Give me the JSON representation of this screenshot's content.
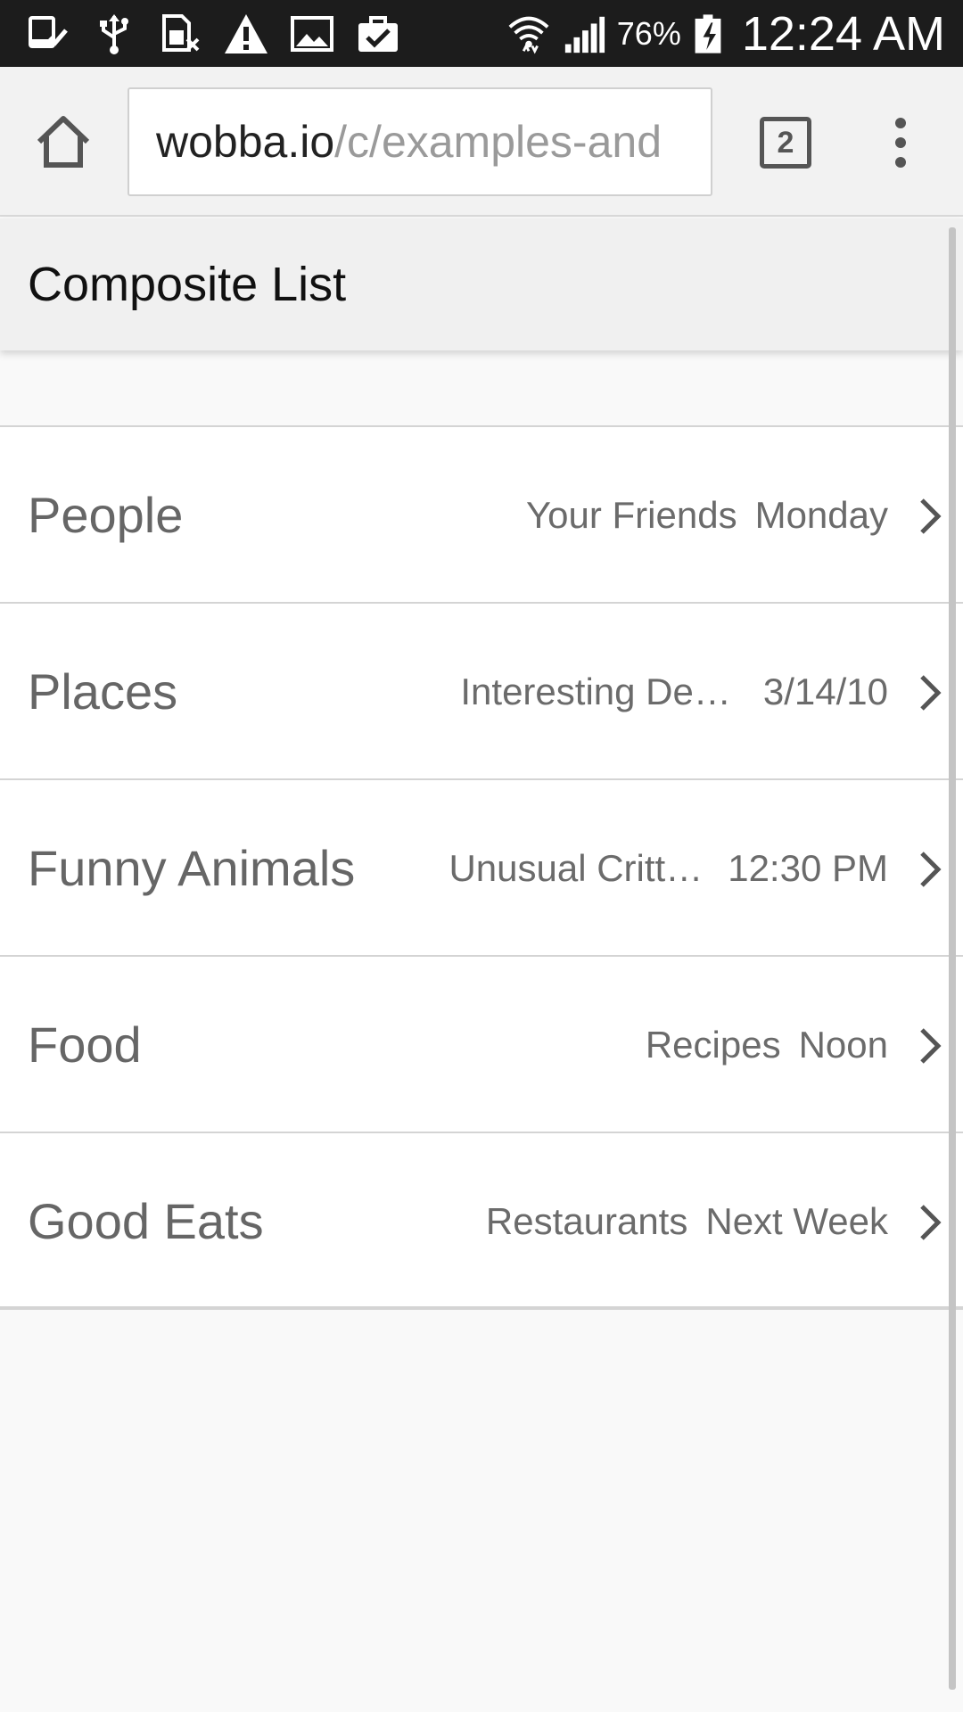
{
  "status_bar": {
    "icons_left": [
      "download-done-icon",
      "usb-icon",
      "sim-card-error-icon",
      "warning-icon",
      "gallery-icon",
      "clipboard-check-icon"
    ],
    "icons_right": [
      "wifi-icon",
      "cell-signal-icon",
      "battery-charging-icon"
    ],
    "battery": "76%",
    "time": "12:24 AM"
  },
  "browser": {
    "url_host": "wobba.io",
    "url_path": "/c/examples-and",
    "tab_count": "2",
    "icons": [
      "home-icon",
      "tabs-icon",
      "more-vert-icon"
    ]
  },
  "page": {
    "title": "Composite List",
    "items": [
      {
        "title": "People",
        "subtitle": "Your Friends",
        "date": "Monday"
      },
      {
        "title": "Places",
        "subtitle": "Interesting De…",
        "date": "3/14/10"
      },
      {
        "title": "Funny Animals",
        "subtitle": "Unusual Critt…",
        "date": "12:30 PM"
      },
      {
        "title": "Food",
        "subtitle": "Recipes",
        "date": "Noon"
      },
      {
        "title": "Good Eats",
        "subtitle": "Restaurants",
        "date": "Next Week"
      }
    ]
  },
  "colors": {
    "status_bar_bg": "#1c1c1c",
    "toolbar_bg": "#f2f2f2",
    "header_bg": "#f0f0f0",
    "item_text": "#666666",
    "divider": "#d4d4d4"
  }
}
